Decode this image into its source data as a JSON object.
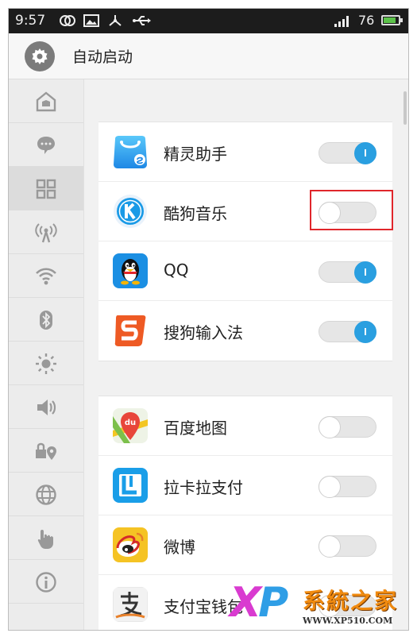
{
  "status_bar": {
    "time": "9:57",
    "battery_level": "76",
    "icons": [
      "dual-sim-icon",
      "image-icon",
      "share-icon",
      "usb-icon",
      "signal-icon",
      "battery-icon"
    ]
  },
  "header": {
    "title": "自动启动",
    "icon": "gear-icon"
  },
  "sidebar": {
    "items": [
      {
        "icon": "home-icon"
      },
      {
        "icon": "chat-bubble-icon"
      },
      {
        "icon": "apps-grid-icon",
        "active": true
      },
      {
        "icon": "hotspot-icon"
      },
      {
        "icon": "wifi-icon"
      },
      {
        "icon": "bluetooth-icon"
      },
      {
        "icon": "brightness-icon"
      },
      {
        "icon": "volume-icon"
      },
      {
        "icon": "lock-location-icon"
      },
      {
        "icon": "globe-icon"
      },
      {
        "icon": "touch-hand-icon"
      },
      {
        "icon": "info-icon"
      }
    ]
  },
  "groups": [
    {
      "apps": [
        {
          "label": "精灵助手",
          "icon": "app-store-bag-icon",
          "enabled": true
        },
        {
          "label": "酷狗音乐",
          "icon": "kugou-music-icon",
          "enabled": false
        },
        {
          "label": "QQ",
          "icon": "qq-penguin-icon",
          "enabled": true
        },
        {
          "label": "搜狗输入法",
          "icon": "sogou-input-icon",
          "enabled": true
        }
      ]
    },
    {
      "apps": [
        {
          "label": "百度地图",
          "icon": "baidu-map-icon",
          "enabled": false
        },
        {
          "label": "拉卡拉支付",
          "icon": "lakala-pay-icon",
          "enabled": false
        },
        {
          "label": "微博",
          "icon": "weibo-icon",
          "enabled": false
        },
        {
          "label": "支付宝钱包",
          "icon": "alipay-wallet-icon",
          "enabled": false
        }
      ]
    }
  ],
  "watermark": {
    "x": "X",
    "p": "P",
    "brand": "系統之家",
    "url": "WWW.XP510.COM"
  },
  "colors": {
    "toggle_on": "#2a9fe0",
    "highlight": "#e0262b",
    "watermark_orange": "#f08a0f",
    "watermark_pink": "#d93bd0",
    "watermark_blue": "#2f9ee6"
  }
}
